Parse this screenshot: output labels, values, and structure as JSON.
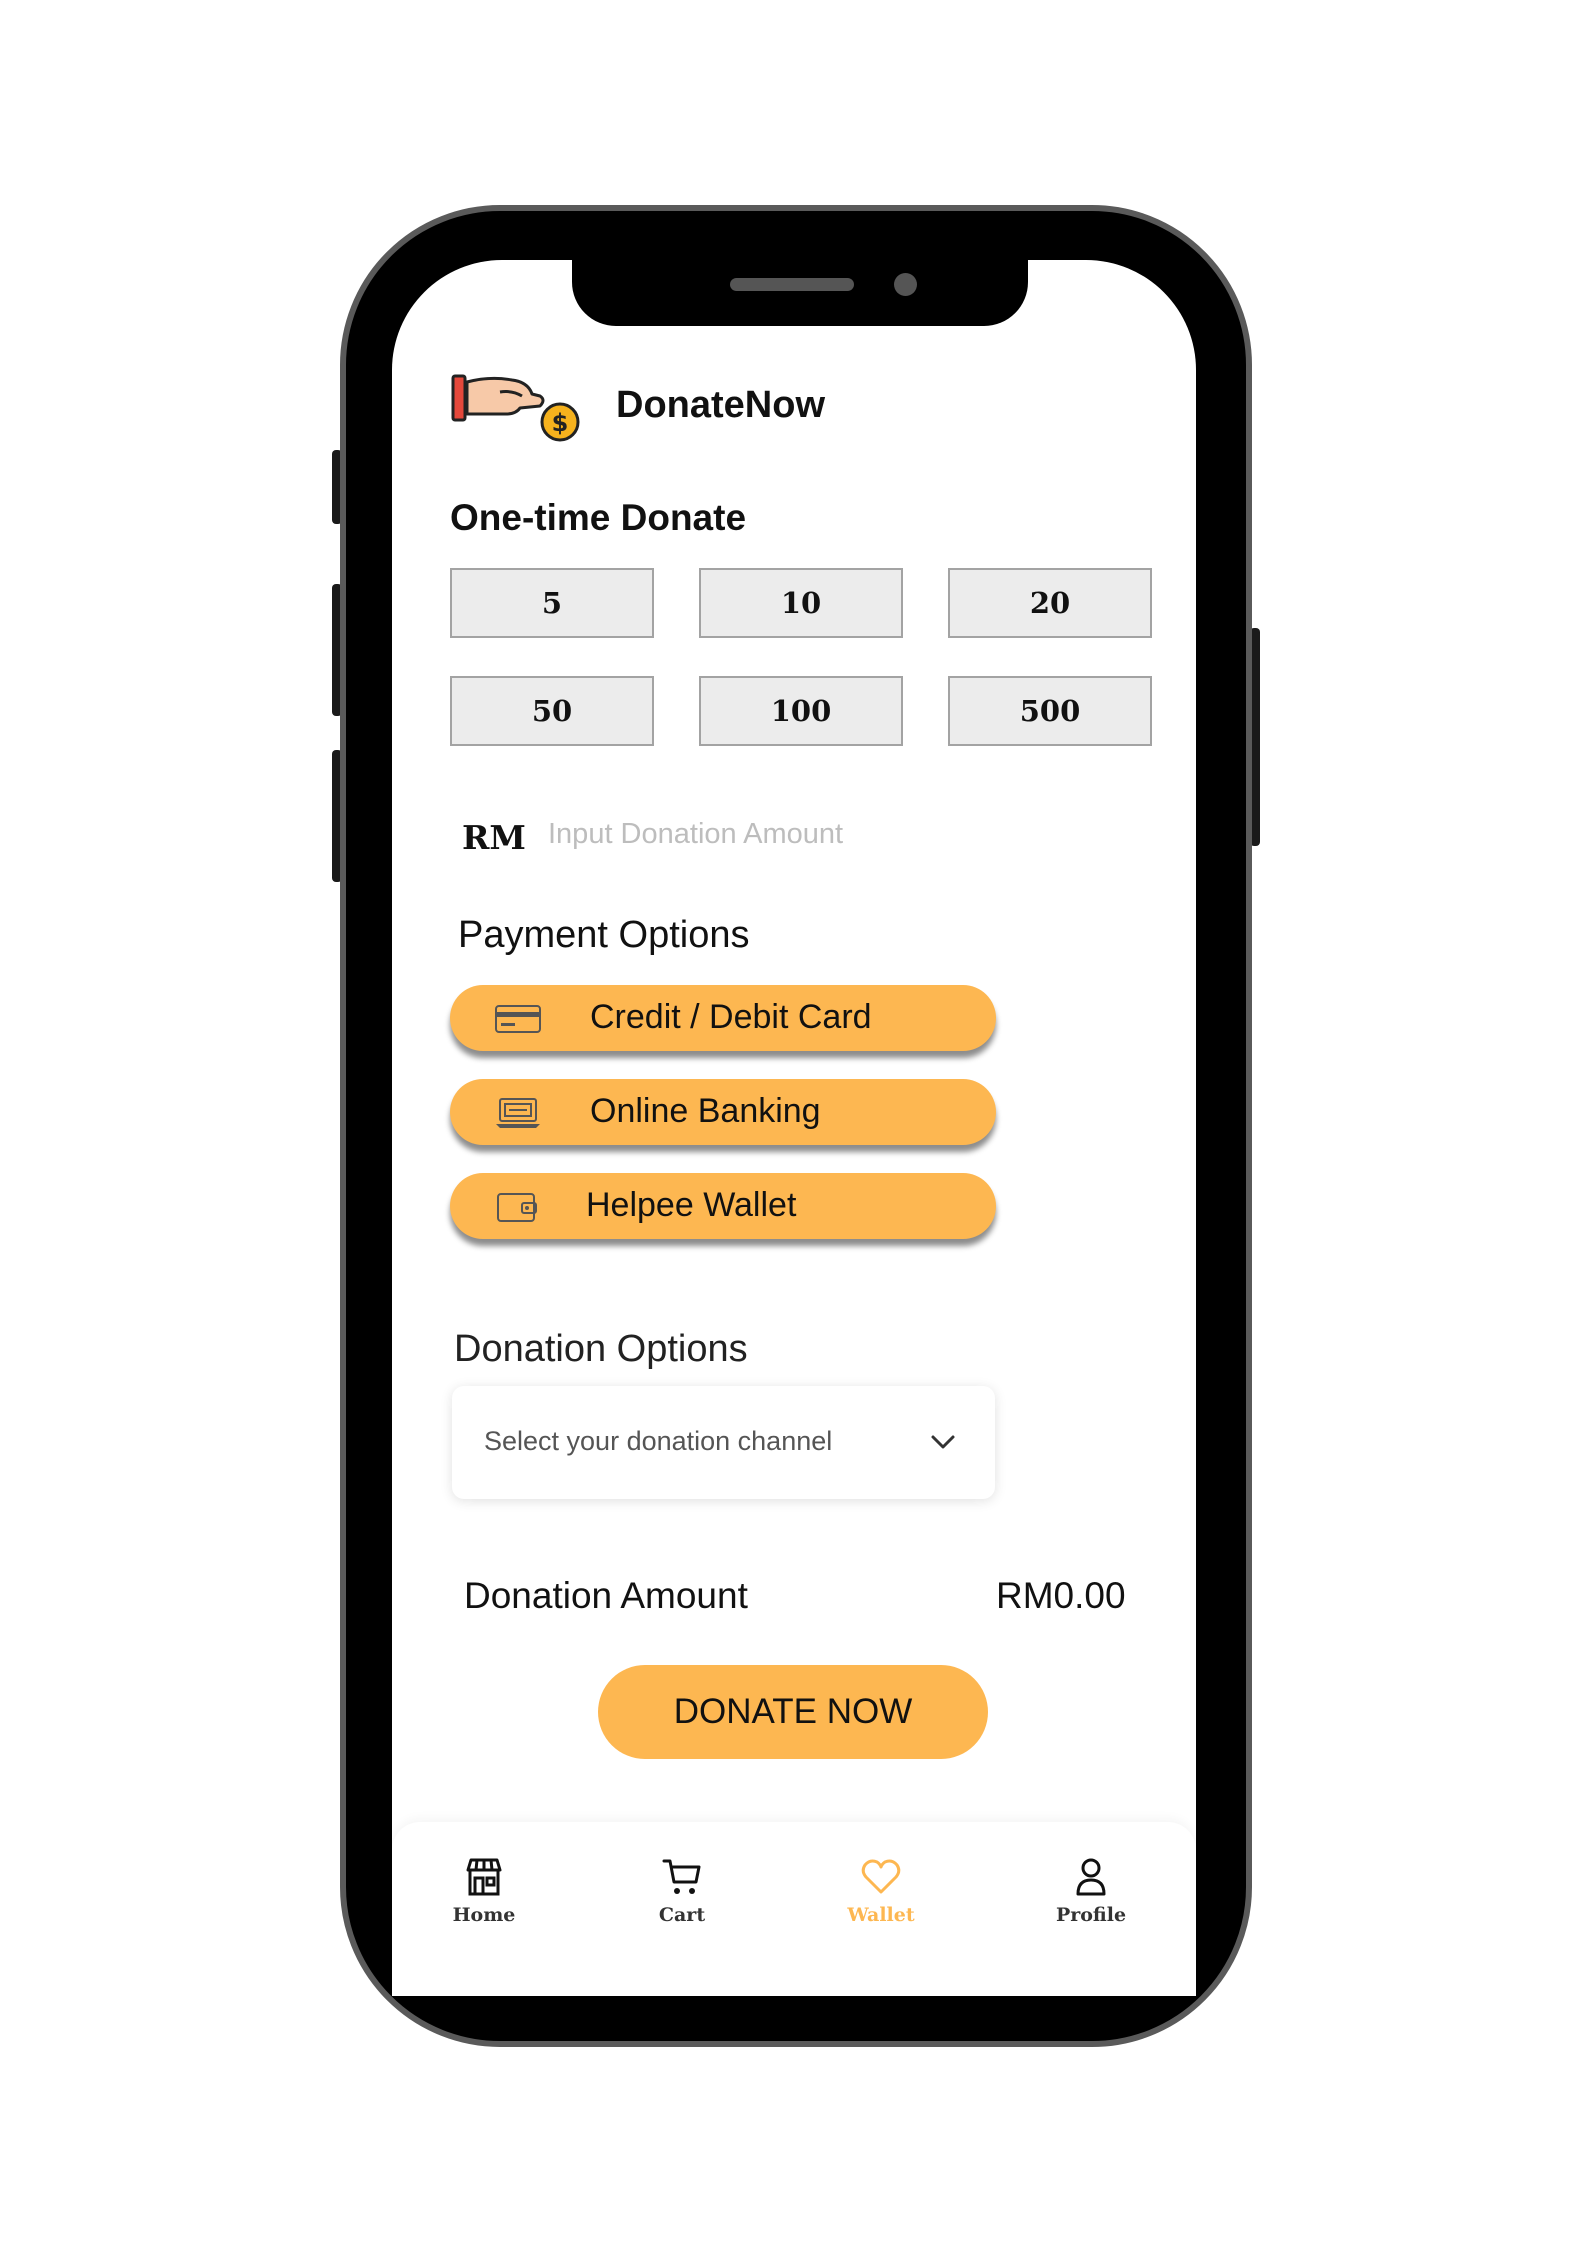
{
  "app": {
    "title": "DonateNow",
    "logo_icon": "hand-giving-coin-icon"
  },
  "one_time": {
    "title": "One-time Donate",
    "amounts": [
      "5",
      "10",
      "20",
      "50",
      "100",
      "500"
    ]
  },
  "custom_amount": {
    "currency": "RM",
    "placeholder": "Input Donation Amount",
    "value": ""
  },
  "payment": {
    "title": "Payment Options",
    "options": [
      {
        "label": "Credit / Debit Card",
        "icon": "credit-card-icon"
      },
      {
        "label": "Online Banking",
        "icon": "online-banking-icon"
      },
      {
        "label": "Helpee Wallet",
        "icon": "wallet-icon"
      }
    ]
  },
  "donation_options": {
    "title": "Donation Options",
    "placeholder": "Select your donation channel",
    "icon": "chevron-down-icon"
  },
  "summary": {
    "label": "Donation Amount",
    "value": "RM0.00"
  },
  "cta": {
    "label": "DONATE NOW"
  },
  "nav": {
    "items": [
      {
        "label": "Home",
        "icon": "store-icon",
        "active": false
      },
      {
        "label": "Cart",
        "icon": "cart-icon",
        "active": false
      },
      {
        "label": "Wallet",
        "icon": "heart-icon",
        "active": true
      },
      {
        "label": "Profile",
        "icon": "user-icon",
        "active": false
      }
    ]
  },
  "colors": {
    "accent": "#fdb751",
    "button_gray": "#ececec",
    "text": "#111111",
    "placeholder": "#bdbdbd"
  }
}
